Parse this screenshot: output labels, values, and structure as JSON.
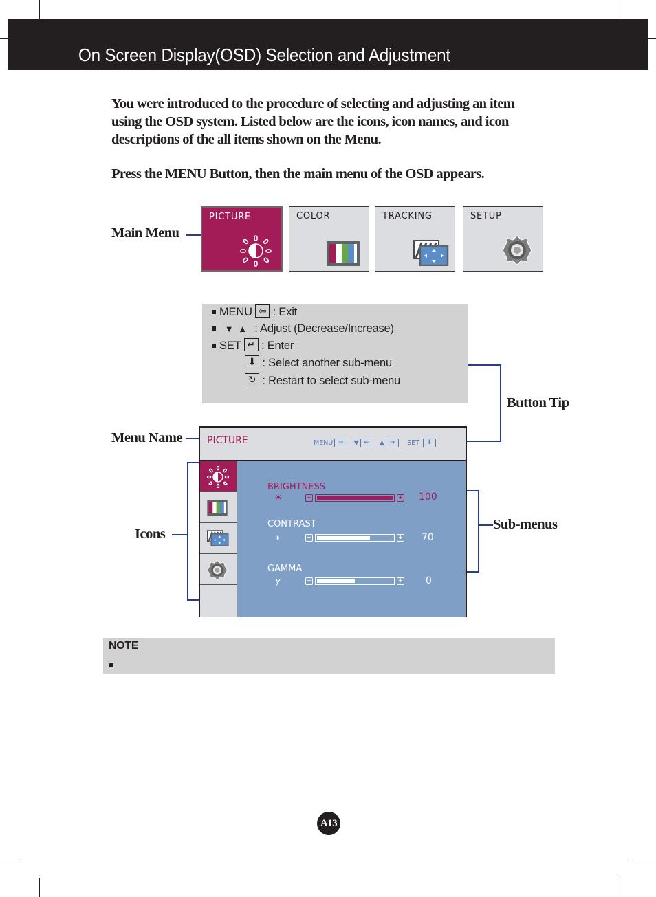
{
  "header": {
    "title": "On Screen Display(OSD) Selection and Adjustment"
  },
  "intro": {
    "paragraph_lines": [
      "You were introduced to the procedure of selecting and adjusting an item",
      "using the OSD system.  Listed below are the icons, icon names, and icon",
      "descriptions of the all items shown on the Menu."
    ],
    "instruction": "Press the MENU Button, then the main menu of the OSD appears."
  },
  "callouts": {
    "main_menu": "Main Menu",
    "button_tip": "Button Tip",
    "menu_name": "Menu Name",
    "icons": "Icons",
    "sub_menus": "Sub-menus"
  },
  "main_menu": {
    "tiles": [
      {
        "label": "PICTURE",
        "icon": "brightness-icon",
        "active": true
      },
      {
        "label": "COLOR",
        "icon": "color-bars-icon",
        "active": false
      },
      {
        "label": "TRACKING",
        "icon": "tracking-icon",
        "active": false
      },
      {
        "label": "SETUP",
        "icon": "gear-icon",
        "active": false
      }
    ]
  },
  "button_tips": [
    {
      "key": "MENU",
      "icon": "exit-icon",
      "desc": ": Exit"
    },
    {
      "key": "",
      "icon": "down-up-triangles-icon",
      "desc": ": Adjust (Decrease/Increase)"
    },
    {
      "key": "SET",
      "icon": "enter-icon",
      "desc": ": Enter"
    },
    {
      "key": "",
      "icon": "down-arrow-icon",
      "desc": ": Select another sub-menu"
    },
    {
      "key": "",
      "icon": "restart-icon",
      "desc": ": Restart to select sub-menu"
    }
  ],
  "osd": {
    "menu_name": "PICTURE",
    "tips": {
      "menu": "MENU",
      "set": "SET"
    },
    "side_icons": [
      "brightness-icon",
      "color-bars-icon",
      "tracking-icon",
      "gear-icon"
    ],
    "submenus": [
      {
        "name": "BRIGHTNESS",
        "icon_glyph": "☀",
        "value": "100",
        "level": 1.0,
        "selected": true
      },
      {
        "name": "CONTRAST",
        "icon_glyph": "◑",
        "value": "70",
        "level": 0.7,
        "selected": false
      },
      {
        "name": "GAMMA",
        "icon_glyph": "γ",
        "value": "0",
        "level": 0.5,
        "selected": false
      }
    ]
  },
  "note": {
    "title": "NOTE",
    "text": ""
  },
  "page_number": "A13",
  "colors": {
    "accent": "#a31c58",
    "osd_blue": "#7f9fc6",
    "callout_line": "#283d8c",
    "header_bg": "#231f20"
  }
}
